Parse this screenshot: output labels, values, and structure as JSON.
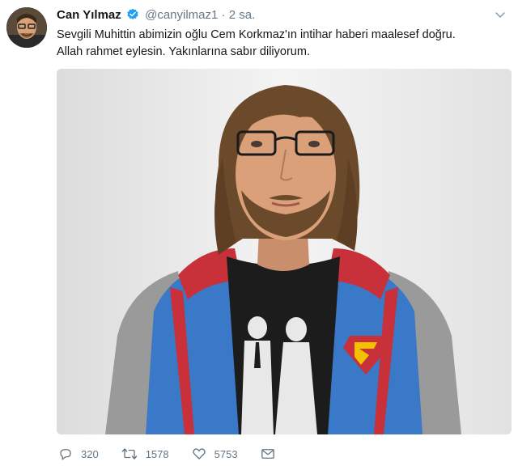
{
  "tweet": {
    "author_name": "Can Yılmaz",
    "handle": "@canyilmaz1",
    "separator": "·",
    "time": "2 sa.",
    "text_line1": "Sevgili Muhittin abimizin oğlu Cem Korkmaz'ın intihar haberi maalesef doğru.",
    "text_line2": "Allah rahmet eylesin. Yakınlarına sabır diliyorum.",
    "verified": true,
    "icons": {
      "verified": "verified-badge-icon",
      "menu": "chevron-down-icon",
      "reply": "reply-icon",
      "retweet": "retweet-icon",
      "like": "heart-icon",
      "message": "envelope-icon"
    },
    "colors": {
      "verified_blue": "#1da1f2",
      "muted": "#657786",
      "text": "#14171a"
    }
  },
  "stats": {
    "replies": "320",
    "retweets": "1578",
    "likes": "5753"
  }
}
